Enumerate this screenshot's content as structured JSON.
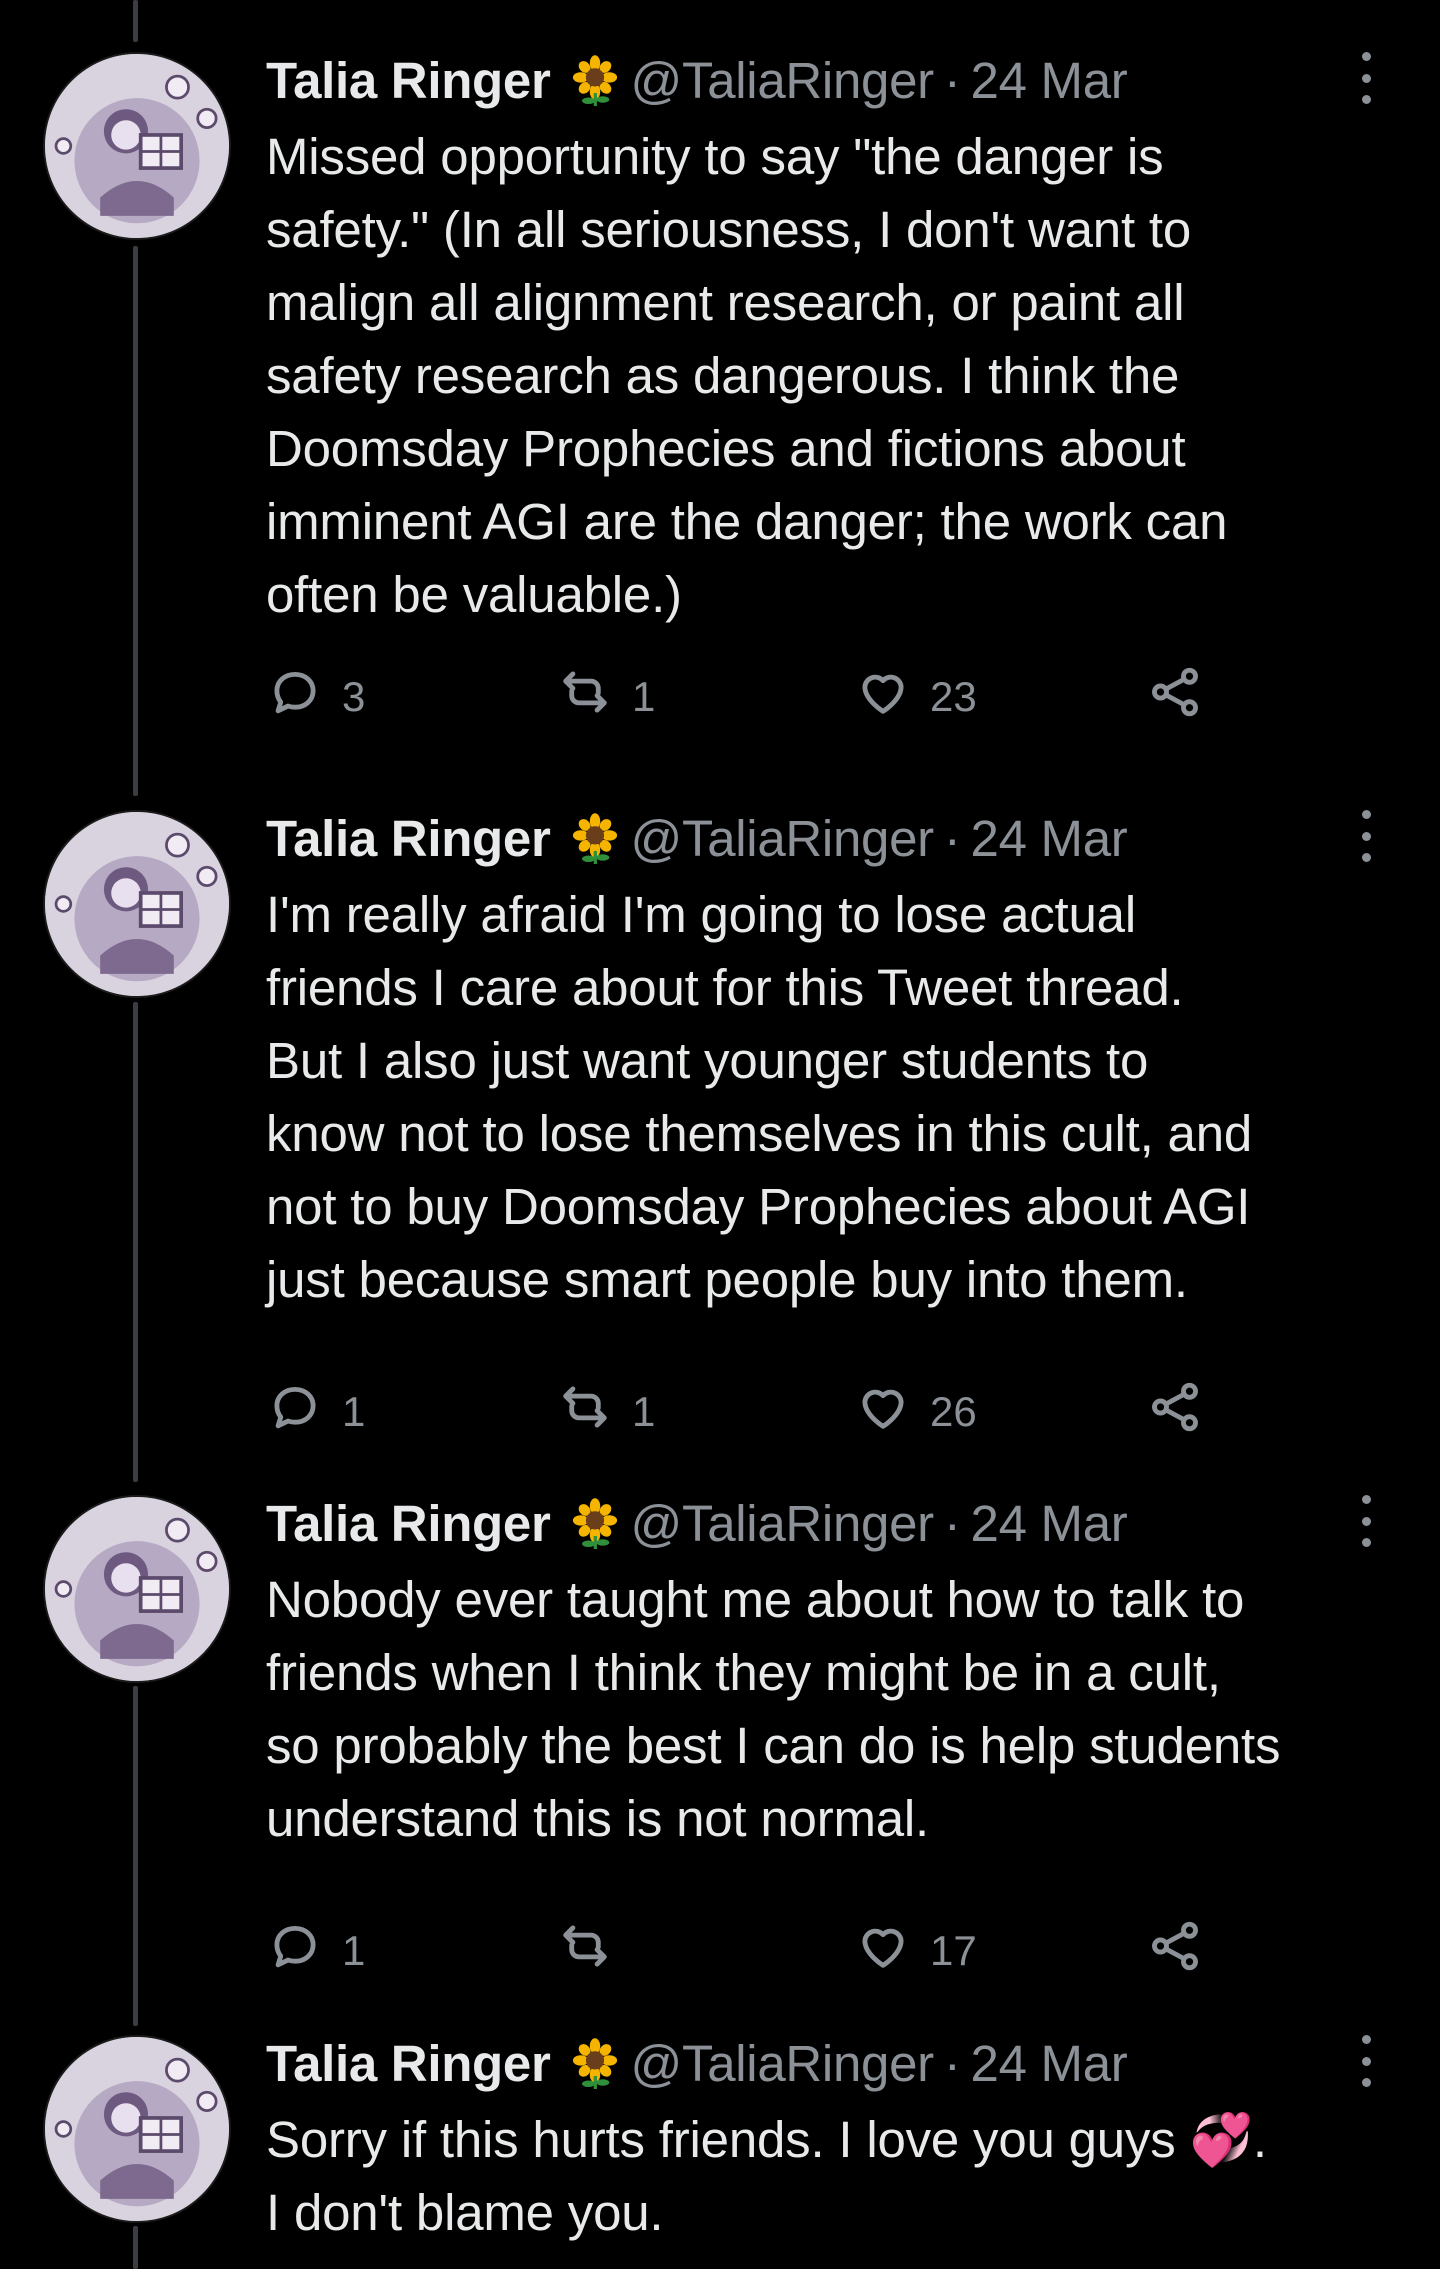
{
  "tweets": [
    {
      "name": "Talia Ringer",
      "handle": "@TaliaRinger",
      "separator": "·",
      "date": "24 Mar",
      "lines": [
        "Missed opportunity to say \"the danger is",
        "safety.\" (In all seriousness, I don't want to",
        "malign all alignment research, or paint all",
        "safety research as dangerous. I think the",
        "Doomsday Prophecies and fictions about",
        "imminent AGI are the danger; the work can",
        "often be valuable.)"
      ],
      "replies": "3",
      "retweets": "1",
      "likes": "23"
    },
    {
      "name": "Talia Ringer",
      "handle": "@TaliaRinger",
      "separator": "·",
      "date": "24 Mar",
      "lines": [
        "I'm really afraid I'm going to lose actual",
        "friends I care about for this Tweet thread.",
        "But I also just want younger students to",
        "know not to lose themselves in this cult, and",
        "not to buy Doomsday Prophecies about AGI",
        "just because smart people buy into them."
      ],
      "replies": "1",
      "retweets": "1",
      "likes": "26"
    },
    {
      "name": "Talia Ringer",
      "handle": "@TaliaRinger",
      "separator": "·",
      "date": "24 Mar",
      "lines": [
        "Nobody ever taught me about how to talk to",
        "friends when I think they might be in a cult,",
        "so probably the best I can do is help students",
        "understand this is not normal."
      ],
      "replies": "1",
      "retweets": "",
      "likes": "17"
    },
    {
      "name": "Talia Ringer",
      "handle": "@TaliaRinger",
      "separator": "·",
      "date": "24 Mar",
      "lines": [
        "Sorry if this hurts friends. I love you guys 💞.",
        "I don't blame you."
      ]
    }
  ],
  "icons": {
    "verified_emoji": "sunflower-icon",
    "reply": "reply-icon",
    "retweet": "retweet-icon",
    "like": "heart-icon",
    "share": "share-icon",
    "more": "more-icon"
  },
  "colors": {
    "background": "#000000",
    "text": "#e7e9ea",
    "muted": "#8b9197",
    "thread_line": "#3a3d41"
  }
}
